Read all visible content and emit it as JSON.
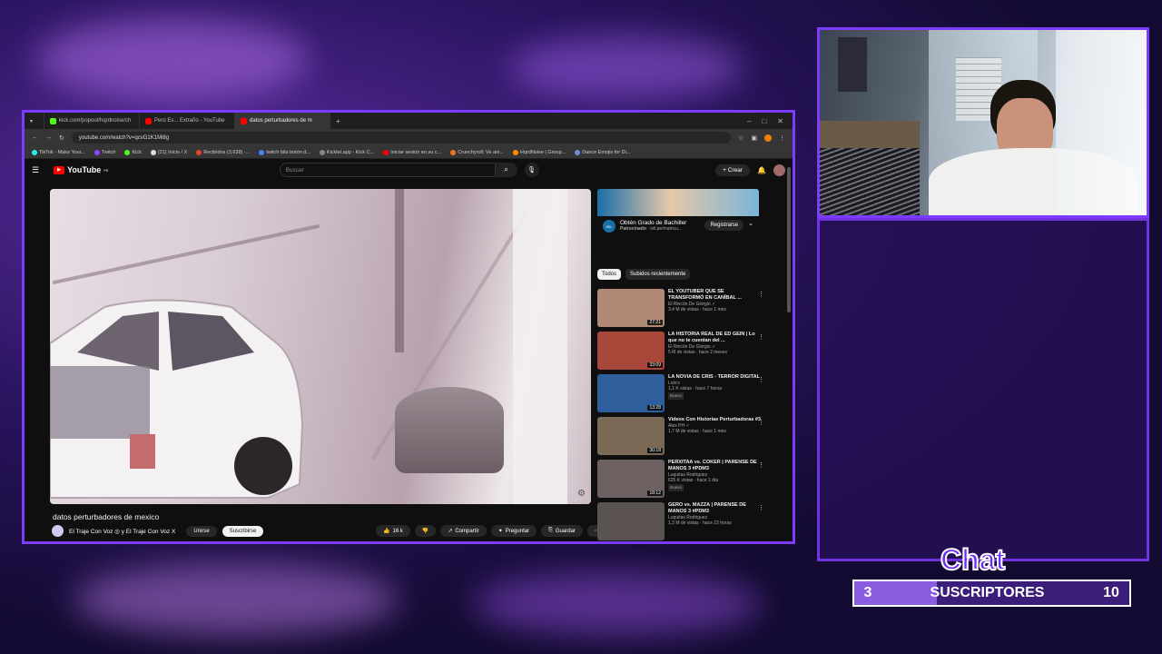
{
  "browser": {
    "tabs": [
      {
        "label": "kick.com/popout/hqrdnoise/ch",
        "color": "#53fc18"
      },
      {
        "label": "Perú Es... Extraño - YouTube",
        "color": "#ff0000"
      },
      {
        "label": "datos perturbadores de m",
        "color": "#ff0000",
        "active": true
      }
    ],
    "url": "youtube.com/watch?v=qcvG1K1Mi8g",
    "bookmarks": [
      "TikTok - Make Your...",
      "Twitch",
      "Kick",
      "(21) Inicio / X",
      "Recibidos (3,638) -...",
      "twitch bits botón d...",
      "Kicklet.app - Kick C...",
      "Iniciar sesión en su c...",
      "Crunchyroll: Ve ani...",
      "HqrdNoise | Group...",
      "Dance Emojis for Di..."
    ]
  },
  "youtube": {
    "logo_text": "YouTube",
    "logo_region": "PE",
    "search_placeholder": "Buscar",
    "create_label": "Crear",
    "video_title": "datos perturbadores de mexico",
    "channel_name": "El Traje Con Voz ◎ y El Traje Con Voz X",
    "join_label": "Unirse",
    "subscribe_label": "Suscribirse",
    "likes": "16 k",
    "share_label": "Compartir",
    "ask_label": "Preguntar",
    "save_label": "Guardar",
    "ad": {
      "banner_tag": "ISIL",
      "title": "Obtén Grado de Bachiller",
      "sponsored": "Patrocinado",
      "url": "isil.pe/matricu...",
      "cta": "Registrarse"
    },
    "chips": [
      "Todos",
      "Subidos recientemente"
    ],
    "recommendations": [
      {
        "title": "EL YOUTUBER QUE SE TRANSFORMÓ EN CANÍBAL ...",
        "channel": "El Rincón De Giorgio ✓",
        "meta": "3,4 M de vistas · hace 1 mes",
        "duration": "27:21",
        "color": "#b08a74",
        "badge": ""
      },
      {
        "title": "LA HISTORIA REAL DE ED GEIN | Lo que no te cuentan del ...",
        "channel": "El Rincón De Giorgio ✓",
        "meta": "5 M de vistas · hace 2 meses",
        "duration": "33:09",
        "color": "#a8473a",
        "badge": ""
      },
      {
        "title": "LA NOVIA DE CRIS - TERROR DIGITAL",
        "channel": "Lolo's",
        "meta": "1,1 K vistas · hace 7 horas",
        "duration": "13:28",
        "color": "#2e5f9c",
        "badge": "Nuevo"
      },
      {
        "title": "Videos Con Historias Perturbadoras #3",
        "channel": "Alex PH ✓",
        "meta": "1,7 M de vistas · hace 1 mes",
        "duration": "30:18",
        "color": "#7a6a55",
        "badge": ""
      },
      {
        "title": "PERXITAA vs. COKER | PARENSE DE MANOS 3 #PDM3",
        "channel": "Luquitas Rodriguez",
        "meta": "625 K vistas · hace 1 día",
        "duration": "18:12",
        "color": "#6c6060",
        "badge": "Nuevo"
      },
      {
        "title": "GERO vs. MAZZA | PARENSE DE MANOS 3 #PDM3",
        "channel": "Luquitas Rodriguez",
        "meta": "1,3 M de vistas · hace 22 horas",
        "duration": "",
        "color": "#5b5252",
        "badge": ""
      }
    ]
  },
  "overlay": {
    "chat_title": "Chat",
    "subs_current": "3",
    "subs_label": "SUSCRIPTORES",
    "subs_goal": "10",
    "subs_progress": 0.3
  }
}
